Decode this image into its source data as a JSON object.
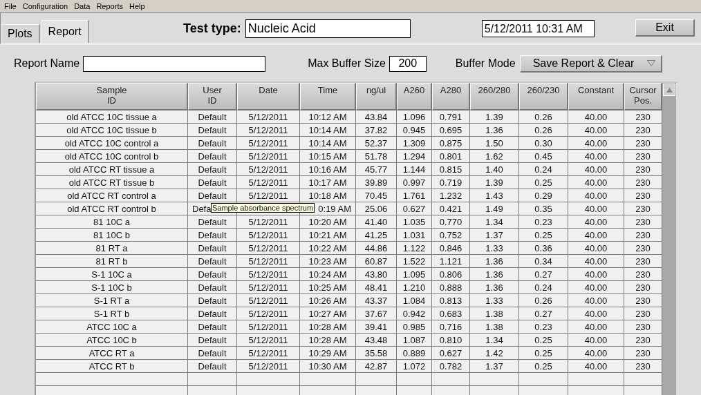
{
  "menu": [
    "File",
    "Configuration",
    "Data",
    "Reports",
    "Help"
  ],
  "tabs": [
    {
      "label": "Plots",
      "selected": false
    },
    {
      "label": "Report",
      "selected": true
    }
  ],
  "test_type": {
    "label": "Test type:",
    "value": "Nucleic Acid"
  },
  "datetime": "5/12/2011  10:31 AM",
  "exit_button": "Exit",
  "report_name": {
    "label": "Report Name"
  },
  "max_buffer": {
    "label": "Max Buffer Size",
    "value": "200"
  },
  "buffer_mode": {
    "label": "Buffer Mode",
    "value": "Save Report & Clear"
  },
  "table": {
    "columns": [
      "Sample\nID",
      "User\nID",
      "Date",
      "Time",
      "ng/ul",
      "A260",
      "A280",
      "260/280",
      "260/230",
      "Constant",
      "Cursor\nPos."
    ],
    "rows": [
      [
        "old ATCC 10C tissue a",
        "Default",
        "5/12/2011",
        "10:12 AM",
        "43.84",
        "1.096",
        "0.791",
        "1.39",
        "0.26",
        "40.00",
        "230"
      ],
      [
        "old ATCC 10C tissue b",
        "Default",
        "5/12/2011",
        "10:14 AM",
        "37.82",
        "0.945",
        "0.695",
        "1.36",
        "0.26",
        "40.00",
        "230"
      ],
      [
        "old ATCC 10C control a",
        "Default",
        "5/12/2011",
        "10:14 AM",
        "52.37",
        "1.309",
        "0.875",
        "1.50",
        "0.30",
        "40.00",
        "230"
      ],
      [
        "old ATCC 10C control b",
        "Default",
        "5/12/2011",
        "10:15 AM",
        "51.78",
        "1.294",
        "0.801",
        "1.62",
        "0.45",
        "40.00",
        "230"
      ],
      [
        "old ATCC RT tissue a",
        "Default",
        "5/12/2011",
        "10:16 AM",
        "45.77",
        "1.144",
        "0.815",
        "1.40",
        "0.24",
        "40.00",
        "230"
      ],
      [
        "old ATCC RT tissue b",
        "Default",
        "5/12/2011",
        "10:17 AM",
        "39.89",
        "0.997",
        "0.719",
        "1.39",
        "0.25",
        "40.00",
        "230"
      ],
      [
        "old ATCC RT control a",
        "Default",
        "5/12/2011",
        "10:18 AM",
        "70.45",
        "1.761",
        "1.232",
        "1.43",
        "0.29",
        "40.00",
        "230"
      ],
      {
        "cells": [
          "old ATCC RT control b",
          "Defa",
          "",
          "0:19 AM",
          "25.06",
          "0.627",
          "0.421",
          "1.49",
          "0.35",
          "40.00",
          "230"
        ],
        "tooltip": "Sample absorbance spectrum"
      },
      [
        "81 10C a",
        "Default",
        "5/12/2011",
        "10:20 AM",
        "41.40",
        "1.035",
        "0.770",
        "1.34",
        "0.23",
        "40.00",
        "230"
      ],
      [
        "81 10C b",
        "Default",
        "5/12/2011",
        "10:21 AM",
        "41.25",
        "1.031",
        "0.752",
        "1.37",
        "0.25",
        "40.00",
        "230"
      ],
      [
        "81 RT a",
        "Default",
        "5/12/2011",
        "10:22 AM",
        "44.86",
        "1.122",
        "0.846",
        "1.33",
        "0.36",
        "40.00",
        "230"
      ],
      [
        "81 RT b",
        "Default",
        "5/12/2011",
        "10:23 AM",
        "60.87",
        "1.522",
        "1.121",
        "1.36",
        "0.34",
        "40.00",
        "230"
      ],
      [
        "S-1 10C a",
        "Default",
        "5/12/2011",
        "10:24 AM",
        "43.80",
        "1.095",
        "0.806",
        "1.36",
        "0.27",
        "40.00",
        "230"
      ],
      [
        "S-1 10C b",
        "Default",
        "5/12/2011",
        "10:25 AM",
        "48.41",
        "1.210",
        "0.888",
        "1.36",
        "0.24",
        "40.00",
        "230"
      ],
      [
        "S-1 RT a",
        "Default",
        "5/12/2011",
        "10:26 AM",
        "43.37",
        "1.084",
        "0.813",
        "1.33",
        "0.26",
        "40.00",
        "230"
      ],
      [
        "S-1 RT b",
        "Default",
        "5/12/2011",
        "10:27 AM",
        "37.67",
        "0.942",
        "0.683",
        "1.38",
        "0.27",
        "40.00",
        "230"
      ],
      [
        "ATCC 10C a",
        "Default",
        "5/12/2011",
        "10:28 AM",
        "39.41",
        "0.985",
        "0.716",
        "1.38",
        "0.23",
        "40.00",
        "230"
      ],
      [
        "ATCC 10C b",
        "Default",
        "5/12/2011",
        "10:28 AM",
        "43.48",
        "1.087",
        "0.810",
        "1.34",
        "0.25",
        "40.00",
        "230"
      ],
      [
        "ATCC RT a",
        "Default",
        "5/12/2011",
        "10:29 AM",
        "35.58",
        "0.889",
        "0.627",
        "1.42",
        "0.25",
        "40.00",
        "230"
      ],
      [
        "ATCC RT b",
        "Default",
        "5/12/2011",
        "10:30 AM",
        "42.87",
        "1.072",
        "0.782",
        "1.37",
        "0.25",
        "40.00",
        "230"
      ]
    ]
  }
}
